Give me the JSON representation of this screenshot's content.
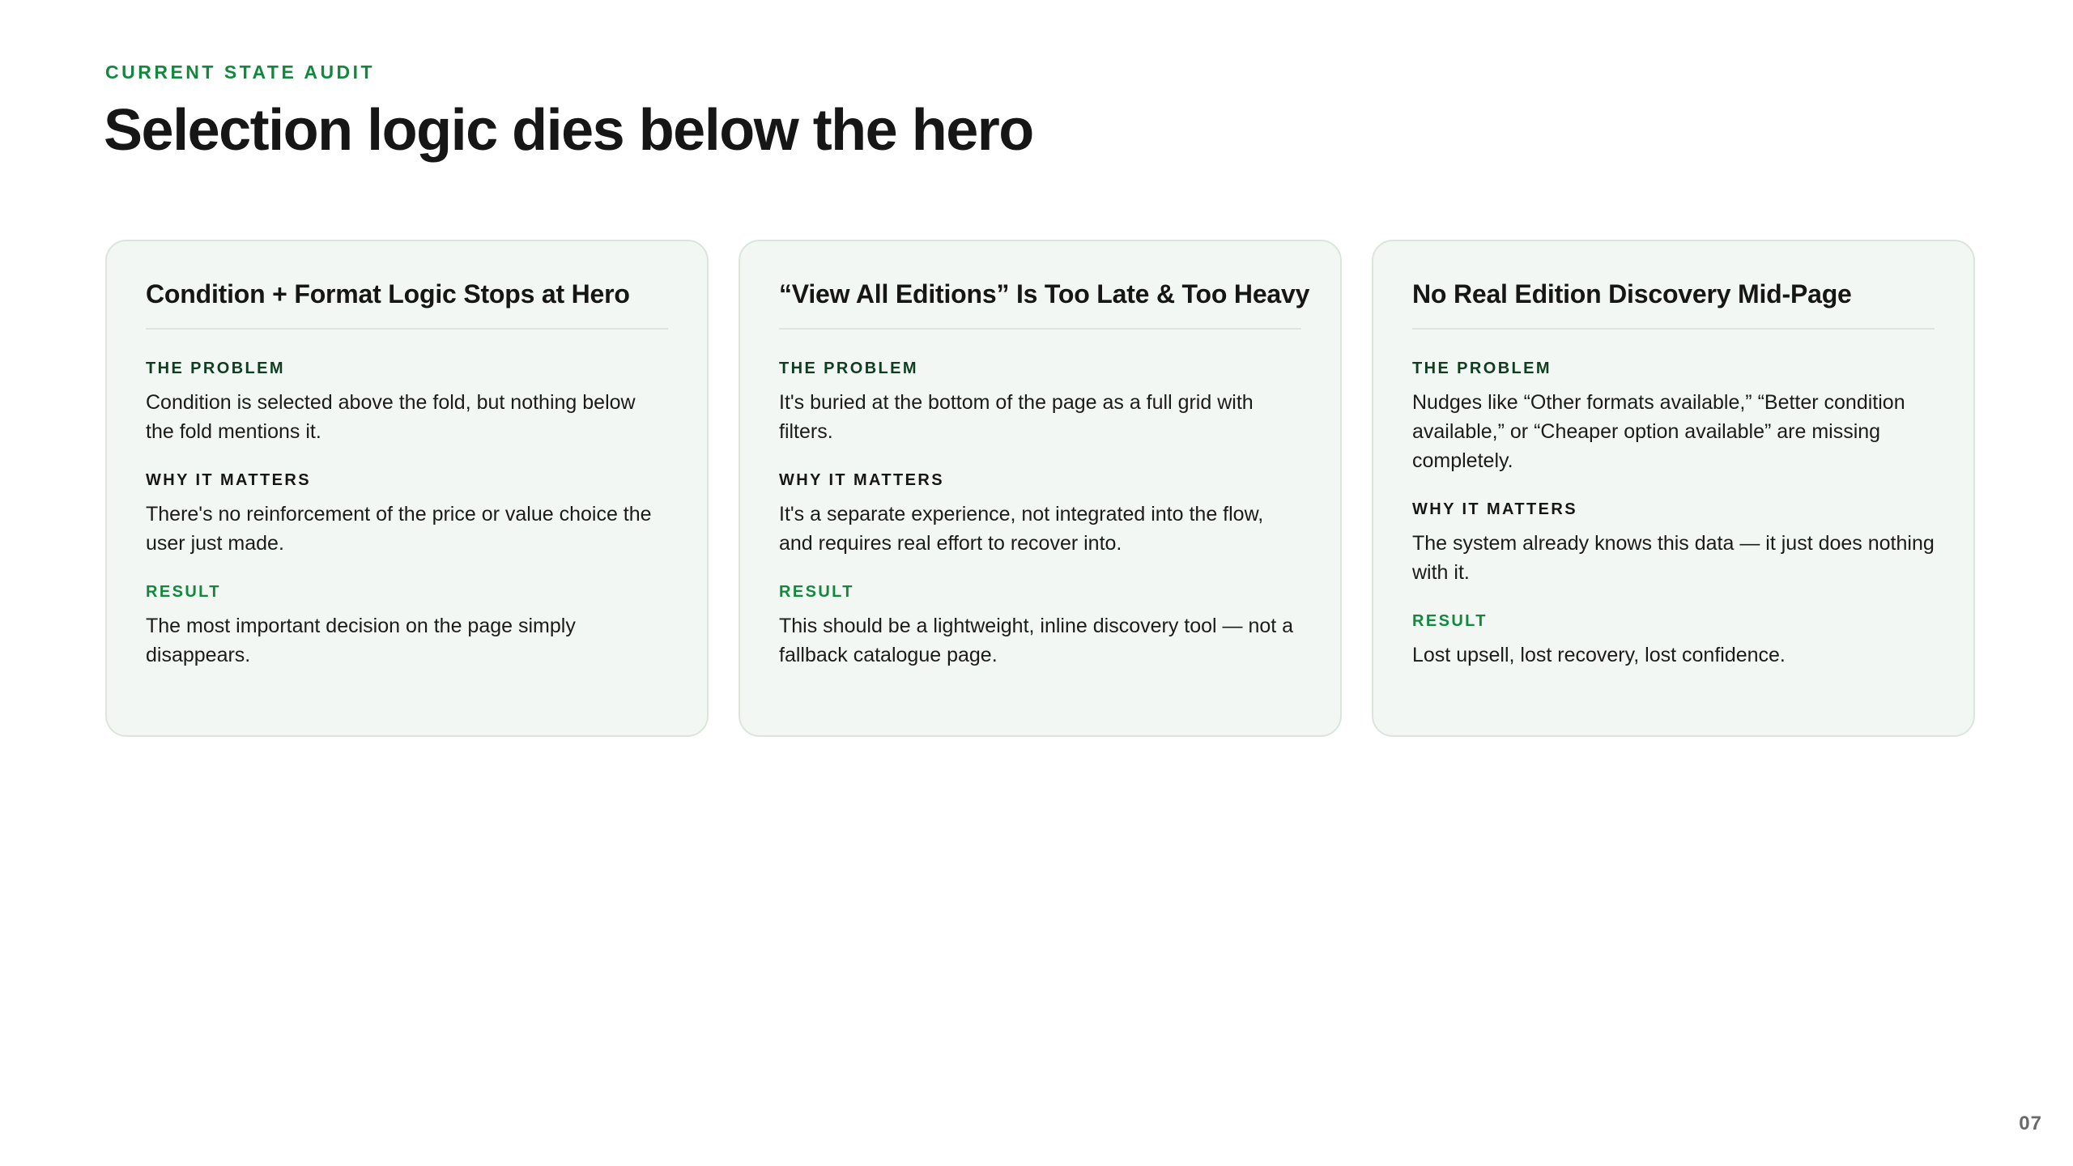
{
  "eyebrow": "CURRENT STATE AUDIT",
  "title": "Selection logic dies below the hero",
  "cards": [
    {
      "title": "Condition + Format Logic Stops at Hero",
      "problem_label": "THE PROBLEM",
      "problem": "Condition is selected above the fold, but nothing below the fold mentions it.",
      "matters_label": "WHY IT MATTERS",
      "matters": "There's no reinforcement of the price or value choice the user just made.",
      "result_label": "RESULT",
      "result": "The most important decision on the page simply disappears."
    },
    {
      "title": "“View All Editions” Is Too Late & Too Heavy",
      "problem_label": "THE PROBLEM",
      "problem": "It's buried at the bottom of the page as a full grid with filters.",
      "matters_label": "WHY IT MATTERS",
      "matters": "It's a separate experience, not integrated into the flow, and requires real effort to recover into.",
      "result_label": "RESULT",
      "result": "This should be a lightweight, inline discovery tool — not a fallback catalogue page."
    },
    {
      "title": "No Real Edition Discovery Mid-Page",
      "problem_label": "THE PROBLEM",
      "problem": "Nudges like “Other formats available,” “Better condition available,” or “Cheaper option available” are missing completely.",
      "matters_label": "WHY IT MATTERS",
      "matters": "The system already knows this data — it just does nothing with it.",
      "result_label": "RESULT",
      "result": "Lost upsell, lost recovery, lost confidence."
    }
  ],
  "page_number": "07",
  "colors": {
    "accent_green": "#14873f",
    "dark_green": "#0f3d22",
    "card_background": "#f3f7f3",
    "card_border": "#dbe5dc"
  }
}
